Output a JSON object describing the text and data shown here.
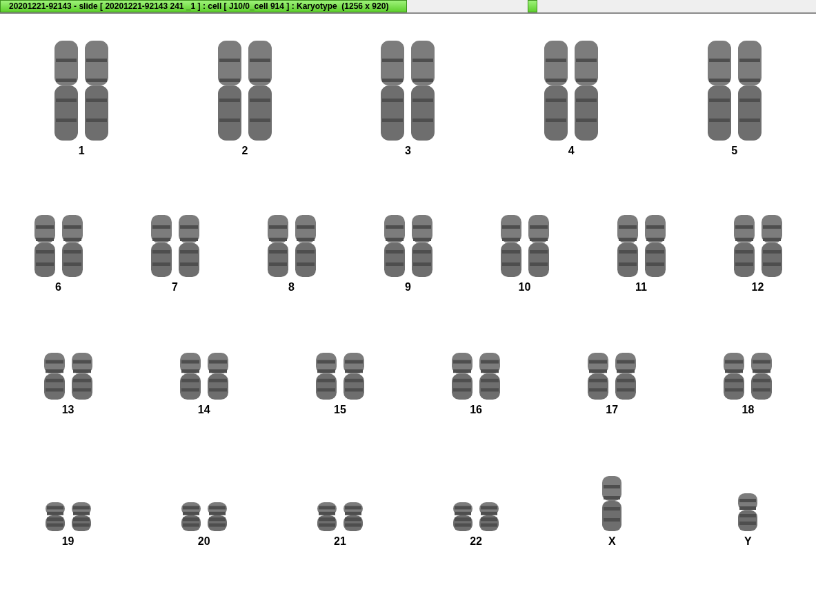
{
  "window": {
    "title": "20201221-92143 - slide [ 20201221-92143 241 _1 ] : cell [ J10/0_cell 914 ] : Karyotype  (1256 x 920)"
  },
  "karyotype": {
    "rows": [
      {
        "items": [
          {
            "label": "1",
            "kind": "pair"
          },
          {
            "label": "2",
            "kind": "pair"
          },
          {
            "label": "3",
            "kind": "pair"
          },
          {
            "label": "4",
            "kind": "pair"
          },
          {
            "label": "5",
            "kind": "pair"
          }
        ]
      },
      {
        "items": [
          {
            "label": "6",
            "kind": "pair"
          },
          {
            "label": "7",
            "kind": "pair"
          },
          {
            "label": "8",
            "kind": "pair"
          },
          {
            "label": "9",
            "kind": "pair"
          },
          {
            "label": "10",
            "kind": "pair"
          },
          {
            "label": "11",
            "kind": "pair"
          },
          {
            "label": "12",
            "kind": "pair"
          }
        ]
      },
      {
        "items": [
          {
            "label": "13",
            "kind": "pair"
          },
          {
            "label": "14",
            "kind": "pair"
          },
          {
            "label": "15",
            "kind": "pair"
          },
          {
            "label": "16",
            "kind": "pair"
          },
          {
            "label": "17",
            "kind": "pair"
          },
          {
            "label": "18",
            "kind": "pair"
          }
        ]
      },
      {
        "items": [
          {
            "label": "19",
            "kind": "pair"
          },
          {
            "label": "20",
            "kind": "pair"
          },
          {
            "label": "21",
            "kind": "pair"
          },
          {
            "label": "22",
            "kind": "pair"
          },
          {
            "label": "X",
            "kind": "single"
          },
          {
            "label": "Y",
            "kind": "single"
          }
        ]
      }
    ]
  }
}
